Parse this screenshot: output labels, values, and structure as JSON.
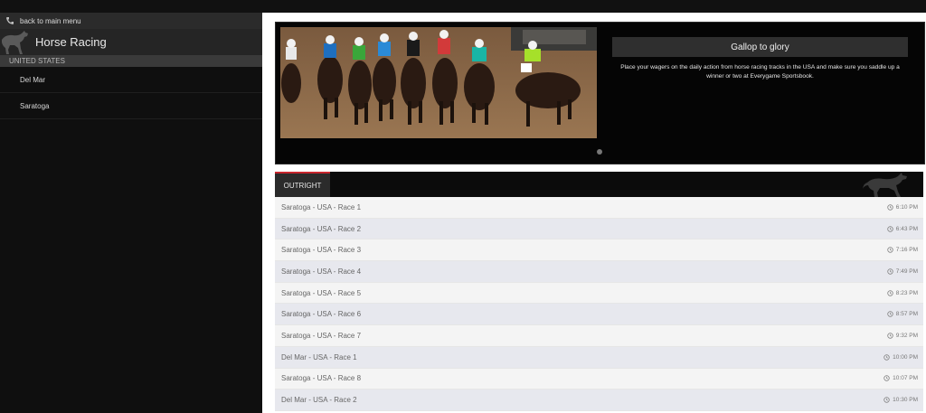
{
  "sidebar": {
    "back_label": "back to main menu",
    "title": "Horse Racing",
    "section": "UNITED STATES",
    "items": [
      {
        "label": "Del Mar"
      },
      {
        "label": "Saratoga"
      }
    ]
  },
  "banner": {
    "headline": "Gallop to glory",
    "description": "Place your wagers on the daily action from horse racing tracks in the USA and make sure you saddle up a winner or two at Everygame Sportsbook."
  },
  "markets": {
    "tab_label": "OUTRIGHT",
    "races": [
      {
        "name": "Saratoga - USA - Race 1",
        "time": "6:10 PM"
      },
      {
        "name": "Saratoga - USA - Race 2",
        "time": "6:43 PM"
      },
      {
        "name": "Saratoga - USA - Race 3",
        "time": "7:16 PM"
      },
      {
        "name": "Saratoga - USA - Race 4",
        "time": "7:49 PM"
      },
      {
        "name": "Saratoga - USA - Race 5",
        "time": "8:23 PM"
      },
      {
        "name": "Saratoga - USA - Race 6",
        "time": "8:57 PM"
      },
      {
        "name": "Saratoga - USA - Race 7",
        "time": "9:32 PM"
      },
      {
        "name": "Del Mar - USA - Race 1",
        "time": "10:00 PM"
      },
      {
        "name": "Saratoga - USA - Race 8",
        "time": "10:07 PM"
      },
      {
        "name": "Del Mar - USA - Race 2",
        "time": "10:30 PM"
      }
    ]
  },
  "colors": {
    "accent": "#c8262d",
    "sidebar_bg": "#0f0f0f",
    "row_odd": "#f4f4f4",
    "row_even": "#e7e8ee"
  },
  "icons": {
    "back": "phone-back-icon",
    "sport": "horse-icon",
    "time": "clock-icon"
  }
}
